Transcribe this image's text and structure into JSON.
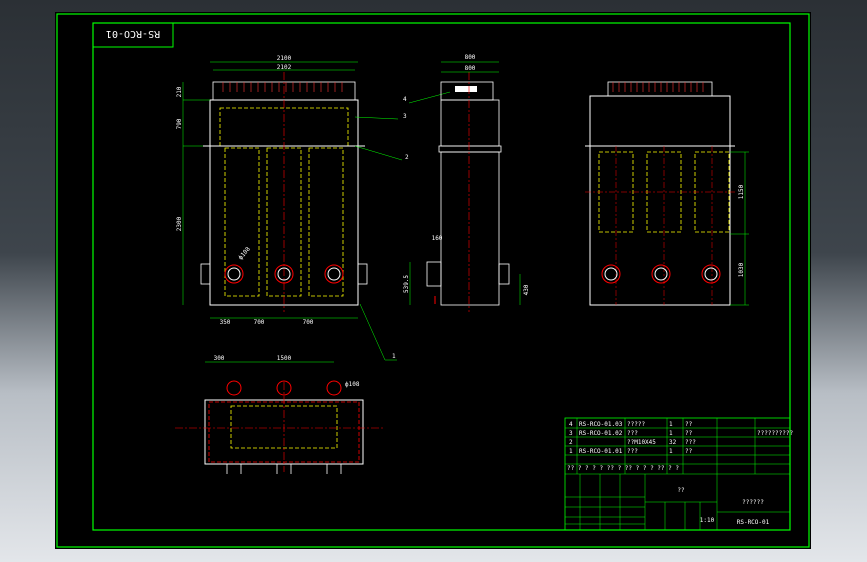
{
  "drawing": {
    "code_label": "RS-RCO-01",
    "colors": {
      "frame": "#00ff00",
      "outline": "#ffffff",
      "hidden": "#ffff00",
      "center": "#ff0000",
      "nozzle": "#ff0000",
      "dimension": "#00ff00"
    },
    "front_view": {
      "dims": {
        "total_width": "2100",
        "inner_width": "2102",
        "left_h1": "210",
        "left_h2": "790",
        "left_h3": "2300",
        "bottom_d1": "350",
        "bottom_d2": "700",
        "bottom_d3": "700",
        "pipe": "ф108"
      },
      "callouts": [
        "1",
        "2",
        "3",
        "4"
      ]
    },
    "side_view": {
      "dims": {
        "top1": "800",
        "top2": "800",
        "nozzle": "160",
        "left_h": "539.5",
        "right_h": "430"
      }
    },
    "right_view": {
      "dims": {
        "upper": "1150",
        "lower": "1030"
      }
    },
    "bottom_view": {
      "dims": {
        "left": "300",
        "span": "1500",
        "pipe": "ф108"
      }
    },
    "title_block": {
      "rows": [
        {
          "no": "4",
          "code": "RS-RCO-01.03",
          "name": "?????",
          "qty": "1",
          "note": "??",
          "extra": ""
        },
        {
          "no": "3",
          "code": "RS-RCO-01.02",
          "name": "???",
          "qty": "1",
          "note": "??",
          "extra": "??????????"
        },
        {
          "no": "2",
          "code": "",
          "name": "??M10X45",
          "qty": "32",
          "note": "???",
          "extra": ""
        },
        {
          "no": "1",
          "code": "RS-RCO-01.01",
          "name": "???",
          "qty": "1",
          "note": "??",
          "extra": ""
        }
      ],
      "header": [
        "??",
        "?",
        "?",
        "?",
        "?",
        "??",
        "?",
        "??",
        "? ? ?",
        "?? ?",
        "?"
      ],
      "center_label": "??",
      "right_label": "??????",
      "drawing_number": "RS-RCO-01",
      "scale": "1:10"
    }
  }
}
